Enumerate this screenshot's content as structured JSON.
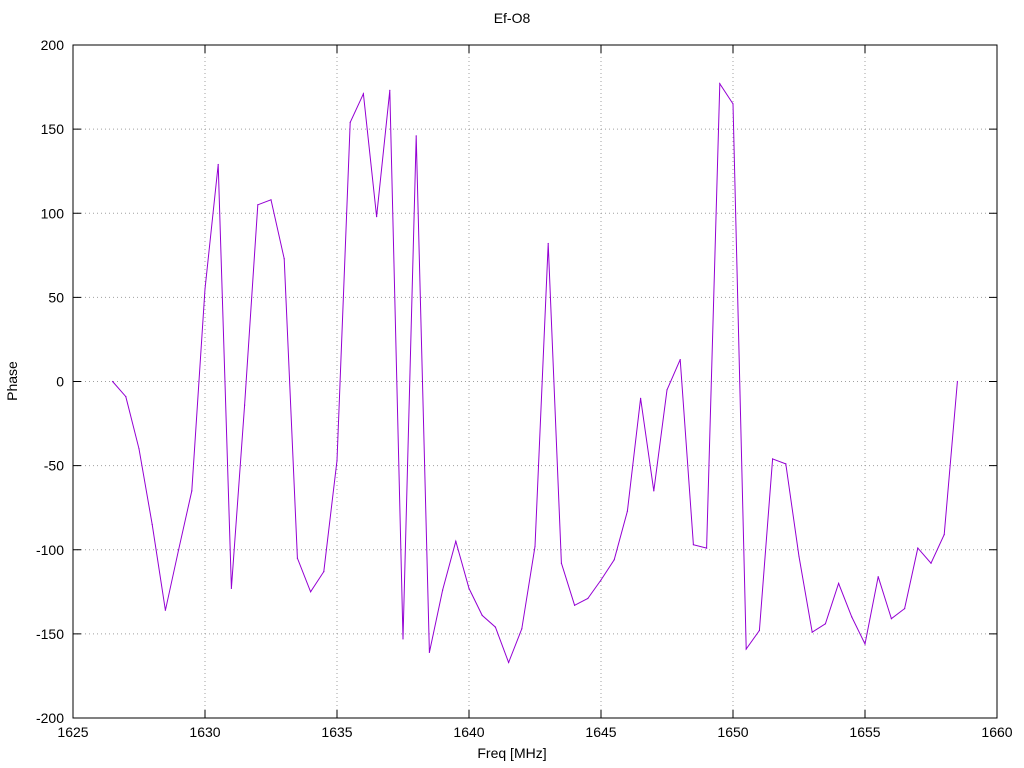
{
  "chart_data": {
    "type": "line",
    "title": "Ef-O8",
    "xlabel": "Freq [MHz]",
    "ylabel": "Phase",
    "xlim": [
      1625,
      1660
    ],
    "ylim": [
      -200,
      200
    ],
    "xticks": [
      1625,
      1630,
      1635,
      1640,
      1645,
      1650,
      1655,
      1660
    ],
    "yticks": [
      -200,
      -150,
      -100,
      -50,
      0,
      50,
      100,
      150,
      200
    ],
    "grid": true,
    "line_color": "#9400d3",
    "series": [
      {
        "x": [
          1626.5,
          1627,
          1627.5,
          1628,
          1628.5,
          1629,
          1629.5,
          1630,
          1630.5,
          1631,
          1631.5,
          1632,
          1632.5,
          1633,
          1633.5,
          1634,
          1634.5,
          1635,
          1635.5,
          1636,
          1636.5,
          1637,
          1637.5,
          1638,
          1638.5,
          1639,
          1639.5,
          1640,
          1640.5,
          1641,
          1641.5,
          1642,
          1642.5,
          1643,
          1643.5,
          1644,
          1644.5,
          1645,
          1645.5,
          1646,
          1646.5,
          1647,
          1647.5,
          1648,
          1648.5,
          1649,
          1649.5,
          1650,
          1650.5,
          1651,
          1651.5,
          1652,
          1652.5,
          1653,
          1653.5,
          1654,
          1654.5,
          1655,
          1655.5,
          1656,
          1656.5,
          1657,
          1657.5,
          1658,
          1658.5
        ],
        "y": [
          0,
          -9,
          -40,
          -85,
          -136,
          -100,
          -65,
          55,
          129,
          -123,
          -14,
          105,
          108,
          73,
          -105,
          -125,
          -113,
          -47,
          154,
          171,
          98,
          173,
          -153,
          146,
          -161,
          -124,
          -95,
          -123,
          -139,
          -146,
          -167,
          -147,
          -98,
          82,
          -108,
          -133,
          -129,
          -118,
          -106,
          -77,
          -10,
          -65,
          -5,
          13,
          -97,
          -99,
          177,
          165,
          -159,
          -148,
          -46,
          -49,
          -104,
          -149,
          -144,
          -120,
          -140,
          -156,
          -116,
          -141,
          -135,
          -99,
          -108,
          -91,
          0
        ]
      }
    ]
  }
}
